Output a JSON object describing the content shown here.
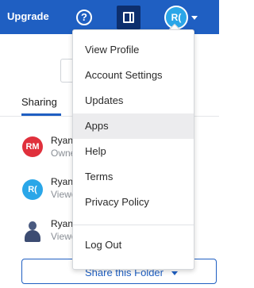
{
  "topbar": {
    "upgrade_label": "Upgrade",
    "help_glyph": "?",
    "avatar_initials": "R(",
    "help_icon": "question-circle-icon",
    "panel_icon": "side-panel-icon",
    "caret_icon": "chevron-down-icon"
  },
  "sharing": {
    "tab_label": "Sharing",
    "members": [
      {
        "initials": "RM",
        "name": "Ryan",
        "role": "Owner",
        "avatar_color": "#e0303c"
      },
      {
        "initials": "R(",
        "name": "Ryan",
        "role": "Viewer",
        "avatar_color": "#2aa6e8"
      },
      {
        "initials": "",
        "name": "Ryan",
        "role": "Viewer",
        "avatar_icon": "person-icon"
      }
    ],
    "share_button_label": "Share this Folder"
  },
  "menu": {
    "items": [
      {
        "label": "View Profile"
      },
      {
        "label": "Account Settings"
      },
      {
        "label": "Updates"
      },
      {
        "label": "Apps",
        "highlighted": true
      },
      {
        "label": "Help"
      },
      {
        "label": "Terms"
      },
      {
        "label": "Privacy Policy"
      },
      {
        "label": "Log Out"
      }
    ]
  },
  "colors": {
    "accent": "#1f5fc2",
    "panel_button": "#0d2f6e",
    "highlight": "#ececee"
  }
}
